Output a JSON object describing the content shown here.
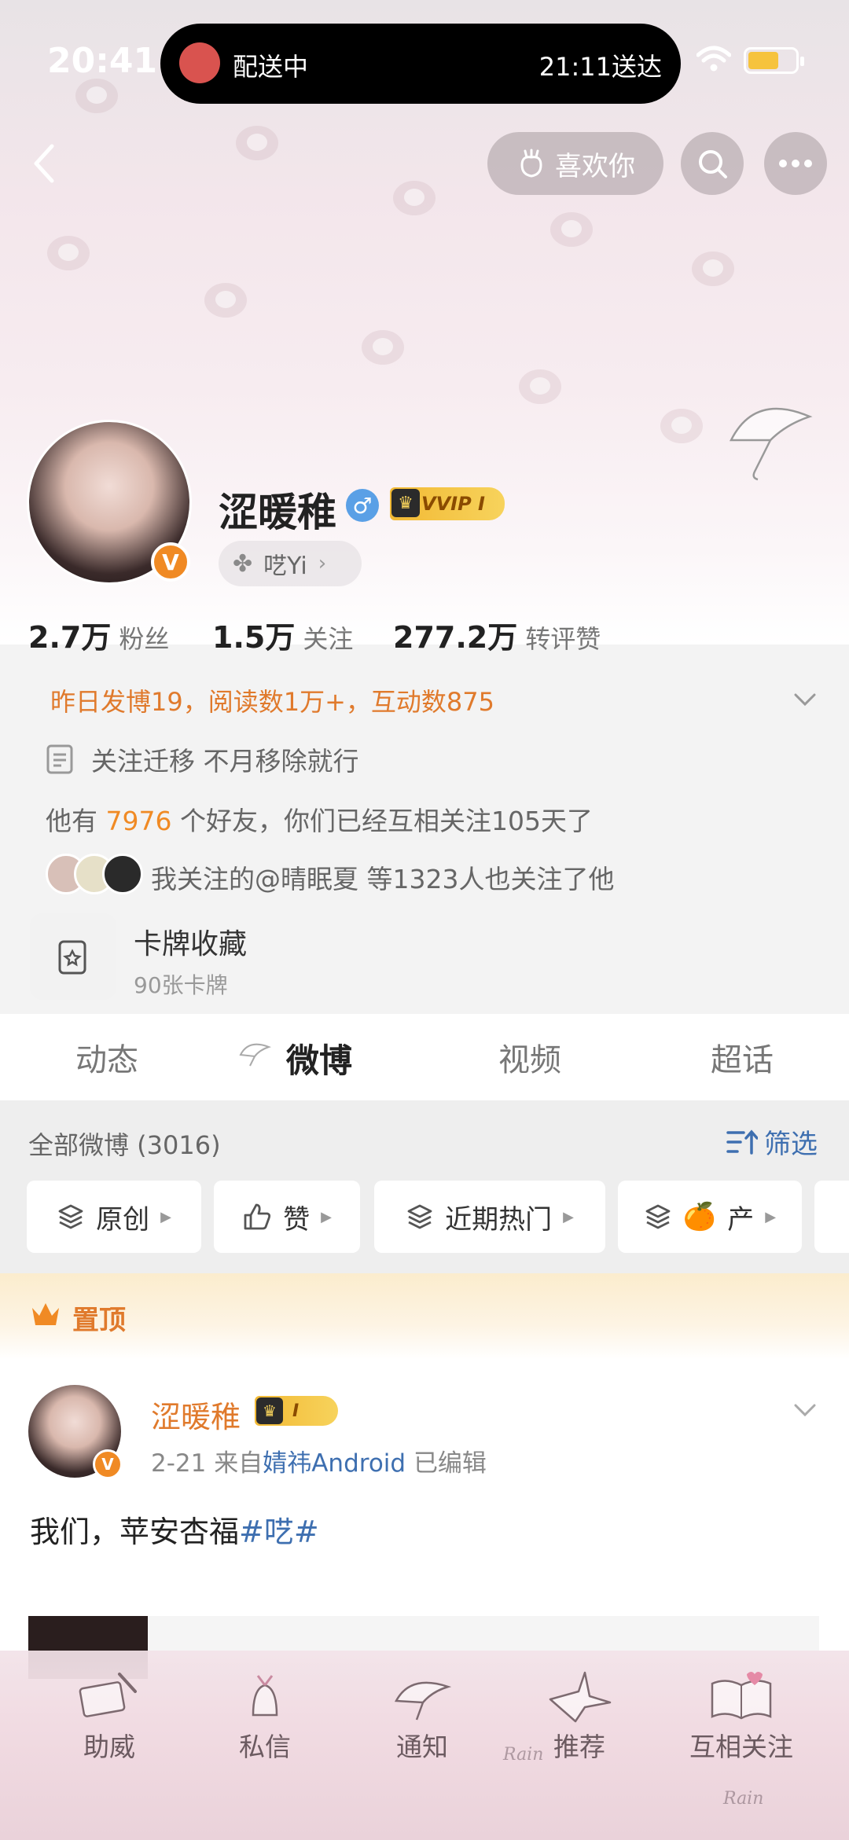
{
  "status_bar": {
    "time": "20:41",
    "island_left": "配送中",
    "island_right": "21:11送达"
  },
  "top_nav": {
    "like_label": "喜欢你"
  },
  "profile": {
    "name": "涩暖稚",
    "vip_label": "VVIP I",
    "group_label": "呓Yi",
    "verify_mark": "V",
    "gender_mark": "♂"
  },
  "stats": [
    {
      "value": "2.7万",
      "label": "粉丝"
    },
    {
      "value": "1.5万",
      "label": "关注"
    },
    {
      "value": "277.2万",
      "label": "转评赞"
    }
  ],
  "info": {
    "daily": "昨日发博19，阅读数1万+，互动数875",
    "bio": "关注迁移 不月移除就行",
    "friend_prefix": "他有",
    "friend_count": "7976",
    "friend_suffix": "个好友，你们已经互相关注105天了",
    "mutual": "我关注的@晴眠夏 等1323人也关注了他"
  },
  "card": {
    "title": "卡牌收藏",
    "subtitle": "90张卡牌"
  },
  "tabs": [
    {
      "label": "动态"
    },
    {
      "label": "微博"
    },
    {
      "label": "视频"
    },
    {
      "label": "超话"
    }
  ],
  "feed": {
    "count_label": "全部微博 (3016)",
    "filter_label": "筛选",
    "chips": [
      {
        "label": "原创"
      },
      {
        "label": "赞"
      },
      {
        "label": "近期热门"
      },
      {
        "label": "产",
        "emoji": "🍊"
      }
    ]
  },
  "pinned": {
    "label": "置顶",
    "post": {
      "author": "涩暖稚",
      "vip_label": "I",
      "date": "2-21",
      "from_prefix": "来自",
      "source": "婧祎Android",
      "edited": "已编辑",
      "text": "我们，苹安杏福",
      "tag": "#呓#"
    }
  },
  "bottom_nav": [
    {
      "label": "助威"
    },
    {
      "label": "私信"
    },
    {
      "label": "通知"
    },
    {
      "label": "推荐"
    },
    {
      "label": "互相关注"
    }
  ],
  "colors": {
    "accent_orange": "#e07a2c",
    "link_blue": "#3e6fb0",
    "vip_gold": "#f2b934"
  }
}
